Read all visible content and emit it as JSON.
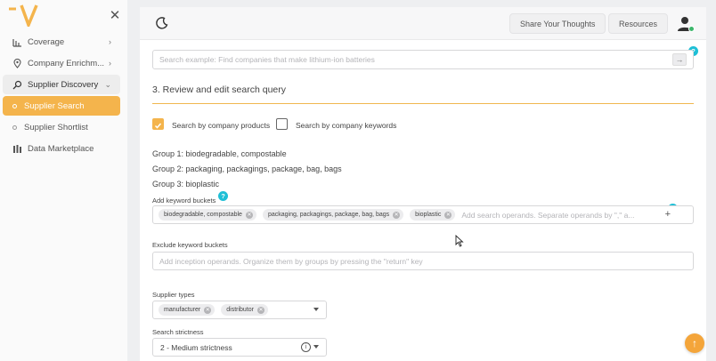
{
  "sidebar": {
    "close_glyph": "✕",
    "items": [
      {
        "label": "Coverage",
        "icon": "bar-chart-icon",
        "chevron": "›"
      },
      {
        "label": "Company Enrichm...",
        "icon": "location-pin-icon",
        "chevron": "›"
      },
      {
        "label": "Supplier Discovery",
        "icon": "search-icon",
        "chevron": "⌄"
      },
      {
        "label": "Supplier Search"
      },
      {
        "label": "Supplier Shortlist"
      },
      {
        "label": "Data Marketplace",
        "icon": "columns-icon"
      }
    ]
  },
  "topbar": {
    "share_label": "Share Your Thoughts",
    "resources_label": "Resources"
  },
  "search": {
    "placeholder": "Search example: Find companies that make lithium-ion batteries",
    "go_glyph": "→",
    "help": "?"
  },
  "section": {
    "title": "3. Review and edit search query"
  },
  "options": {
    "by_products": "Search by company products",
    "by_keywords": "Search by company keywords"
  },
  "groups": [
    "Group 1: biodegradable, compostable",
    "Group 2: packaging, packagings, package, bag, bags",
    "Group 3: bioplastic"
  ],
  "keywords": {
    "label": "Add keyword buckets",
    "help": "?",
    "tags": [
      "biodegradable, compostable",
      "packaging, packagings, package, bag, bags",
      "bioplastic"
    ],
    "placeholder": "Add search operands. Separate operands by \",\" a...",
    "add_glyph": "+"
  },
  "exclude": {
    "label": "Exclude keyword buckets",
    "placeholder": "Add inception operands. Organize them by groups by pressing the \"return\" key"
  },
  "supplier_types": {
    "label": "Supplier types",
    "tags": [
      "manufacturer",
      "distributor"
    ]
  },
  "strictness": {
    "label": "Search strictness",
    "value": "2 - Medium strictness",
    "info_glyph": "i"
  },
  "fab_glyph": "↑",
  "colors": {
    "accent": "#f4b44c",
    "help_badge": "#1fbfd6",
    "online": "#3cb66b"
  }
}
